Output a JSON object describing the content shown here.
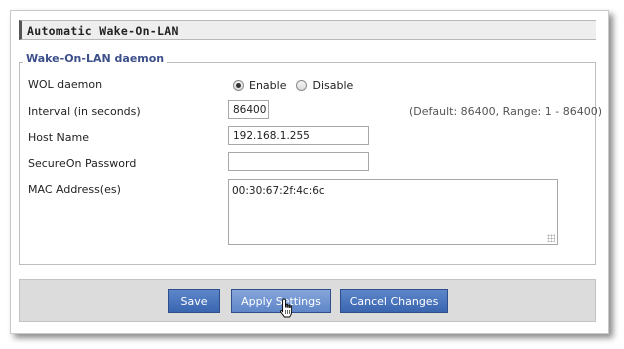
{
  "section_title": "Automatic Wake-On-LAN",
  "group_title": "Wake-On-LAN daemon",
  "fields": {
    "wol_daemon": {
      "label": "WOL daemon",
      "options": [
        {
          "label": "Enable",
          "checked": true
        },
        {
          "label": "Disable",
          "checked": false
        }
      ]
    },
    "interval": {
      "label": "Interval (in seconds)",
      "value": "86400",
      "hint": "(Default: 86400, Range: 1 - 86400)"
    },
    "host_name": {
      "label": "Host Name",
      "value": "192.168.1.255"
    },
    "secureon_password": {
      "label": "SecureOn Password",
      "value": ""
    },
    "mac_addresses": {
      "label": "MAC Address(es)",
      "value": "00:30:67:2f:4c:6c"
    }
  },
  "buttons": {
    "save": "Save",
    "apply": "Apply Settings",
    "cancel": "Cancel Changes"
  },
  "colors": {
    "button": "#3a66b0",
    "button_hover": "#6f94d2",
    "legend": "#3b4f8a"
  }
}
